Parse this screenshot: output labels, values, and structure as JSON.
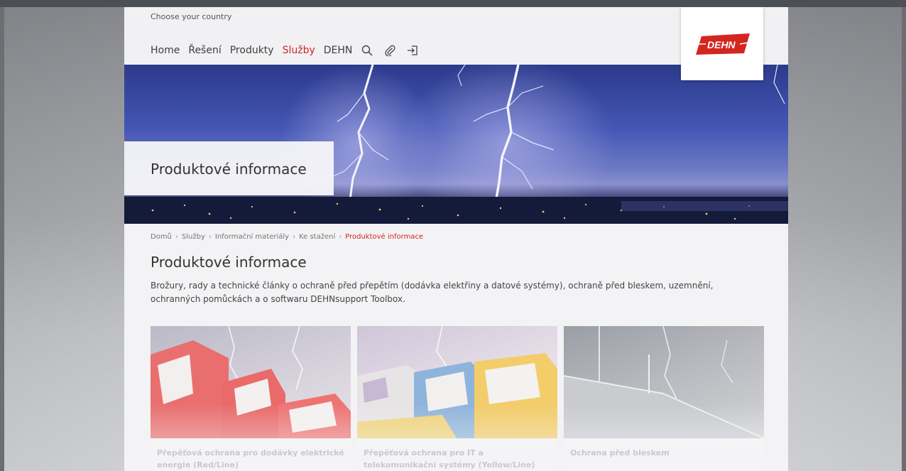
{
  "header": {
    "country_link": "Choose your country",
    "nav": [
      "Home",
      "Řešení",
      "Produkty",
      "Služby",
      "DEHN"
    ],
    "active_nav": "Služby",
    "icons": [
      "search-icon",
      "paperclip-icon",
      "login-icon"
    ],
    "logo_text": "DEHN"
  },
  "hero": {
    "title": "Produktové informace"
  },
  "breadcrumb": [
    "Domů",
    "Služby",
    "Informační materiály",
    "Ke stažení",
    "Produktové informace"
  ],
  "main": {
    "title": "Produktové informace",
    "description": "Brožury, rady a technické články o ochraně před přepětím (dodávka elektřiny a datové systémy), ochraně před bleskem, uzemnění, ochranných pomůckách a o softwaru DEHNsupport Toolbox."
  },
  "cards": [
    {
      "title": "Přepěťová ochrana pro dodávky elektrické energie (Red/Line)"
    },
    {
      "title": "Přepěťová ochrana pro IT a telekomunikační systémy (Yellow/Line)"
    },
    {
      "title": "Ochrana před bleskem"
    }
  ],
  "colors": {
    "accent": "#d2261f",
    "text": "#333333",
    "page_bg": "#f3f3f5"
  }
}
